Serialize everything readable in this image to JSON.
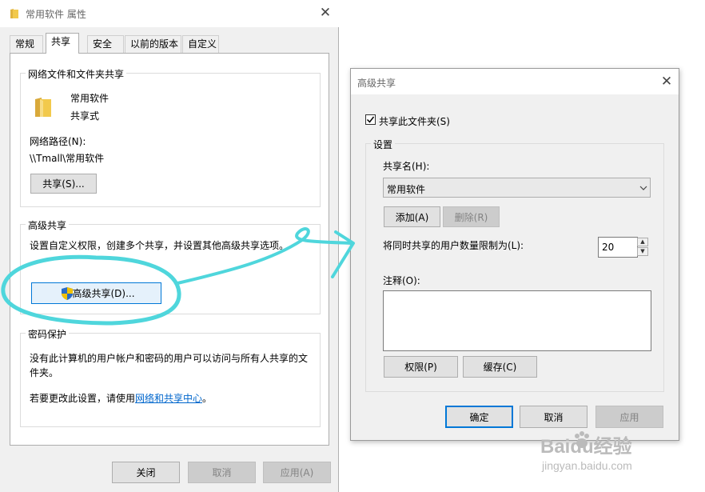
{
  "props_window": {
    "title": "常用软件 属性",
    "tabs": [
      "常规",
      "共享",
      "安全",
      "以前的版本",
      "自定义"
    ],
    "active_tab_index": 1,
    "network_sharing": {
      "legend": "网络文件和文件夹共享",
      "folder_name": "常用软件",
      "share_state": "共享式",
      "path_label": "网络路径(N):",
      "path_value": "\\\\Tmall\\常用软件",
      "share_button": "共享(S)..."
    },
    "advanced_sharing": {
      "legend": "高级共享",
      "description": "设置自定义权限，创建多个共享，并设置其他高级共享选项。",
      "button": "高级共享(D)..."
    },
    "password_protection": {
      "legend": "密码保护",
      "description_line1": "没有此计算机的用户帐户和密码的用户可以访问与所有人共享的文",
      "description_line2": "件夹。",
      "change_prefix": "若要更改此设置，请使用",
      "change_link": "网络和共享中心",
      "change_suffix": "。"
    },
    "buttons": {
      "close": "关闭",
      "cancel": "取消",
      "apply": "应用(A)"
    }
  },
  "adv_dialog": {
    "title": "高级共享",
    "share_checkbox_label": "共享此文件夹(S)",
    "share_checked": true,
    "settings_legend": "设置",
    "share_name_label": "共享名(H):",
    "share_name_value": "常用软件",
    "add_button": "添加(A)",
    "remove_button": "删除(R)",
    "limit_label": "将同时共享的用户数量限制为(L):",
    "limit_value": "20",
    "comment_label": "注释(O):",
    "comment_value": "",
    "permissions_button": "权限(P)",
    "caching_button": "缓存(C)",
    "ok_button": "确定",
    "cancel_button": "取消",
    "apply_button": "应用"
  },
  "watermark": {
    "line1": "Baidu经验",
    "line2": "jingyan.baidu.com"
  },
  "colors": {
    "annotation": "#4fd6dc",
    "accent": "#0078d7",
    "link": "#0066cc",
    "folder": "#f2c94c",
    "shield_blue": "#2b6cc4",
    "shield_yellow": "#f2c200"
  }
}
